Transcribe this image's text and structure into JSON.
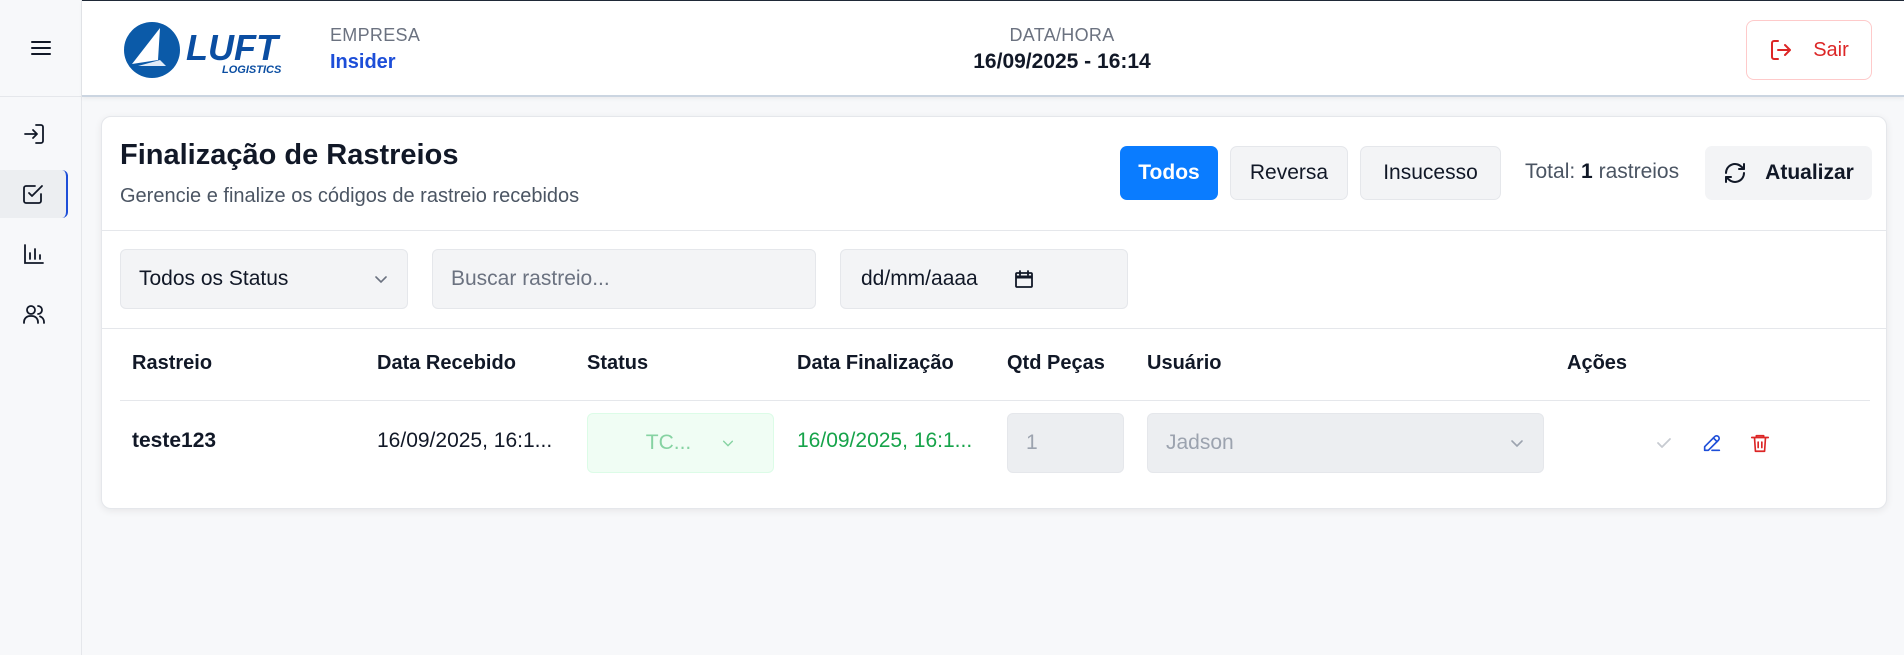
{
  "header": {
    "logo_text": "LUFT",
    "logo_subtext": "LOGISTICS",
    "empresa_label": "EMPRESA",
    "empresa_value": "Insider",
    "datahora_label": "DATA/HORA",
    "datahora_value": "16/09/2025 - 16:14",
    "logout_label": "Sair"
  },
  "sidebar": {
    "items": [
      {
        "icon": "login-icon"
      },
      {
        "icon": "checkbox-icon",
        "active": true
      },
      {
        "icon": "bar-chart-icon"
      },
      {
        "icon": "users-icon"
      }
    ]
  },
  "page": {
    "title": "Finalização de Rastreios",
    "subtitle": "Gerencie e finalize os códigos de rastreio recebidos",
    "filter_tabs": [
      "Todos",
      "Reversa",
      "Insucesso"
    ],
    "total_prefix": "Total:",
    "total_count": "1",
    "total_suffix": "rastreios",
    "refresh_label": "Atualizar"
  },
  "filters": {
    "status_selected": "Todos os Status",
    "search_placeholder": "Buscar rastreio...",
    "date_placeholder": "dd/mm/aaaa"
  },
  "table": {
    "columns": [
      "Rastreio",
      "Data Recebido",
      "Status",
      "Data Finalização",
      "Qtd Peças",
      "Usuário",
      "Ações"
    ],
    "rows": [
      {
        "rastreio": "teste123",
        "data_recebido": "16/09/2025, 16:1...",
        "status": "TC...",
        "data_finalizacao": "16/09/2025, 16:1...",
        "qtd_pecas": "1",
        "usuario": "Jadson"
      }
    ]
  },
  "colors": {
    "accent": "#0a7cff",
    "brand": "#1d4ed8",
    "danger": "#dc2626",
    "success": "#16a34a"
  }
}
